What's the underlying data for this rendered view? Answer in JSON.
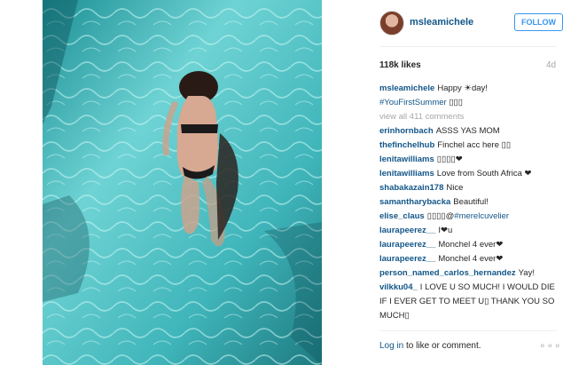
{
  "post": {
    "username": "msleamichele",
    "follow_label": "FOLLOW",
    "likes": "118k likes",
    "time": "4d",
    "caption_user": "msleamichele",
    "caption_text": "Happy ☀day!",
    "caption_tag": "#YouFirstSummer",
    "caption_tag_suffix": "▯▯▯",
    "view_all": "view all 411 comments"
  },
  "comments": [
    {
      "user": "erinhornbach",
      "text": "ASSS YAS MOM"
    },
    {
      "user": "thefinchelhub",
      "text": "Finchel acc here ▯▯"
    },
    {
      "user": "lenitawilliams",
      "text": "▯▯▯▯❤"
    },
    {
      "user": "lenitawilliams",
      "text": "Love from South Africa ❤"
    },
    {
      "user": "shabakazain178",
      "text": "Nice"
    },
    {
      "user": "samantharybacka",
      "text": "Beautiful!"
    },
    {
      "user": "elise_claus",
      "text": "▯▯▯▯@",
      "mention": "#merelcuvelier"
    },
    {
      "user": "laurapeerez__",
      "text": "I❤u"
    },
    {
      "user": "laurapeerez__",
      "text": "Monchel 4 ever❤"
    },
    {
      "user": "laurapeerez__",
      "text": "Monchel 4 ever❤"
    },
    {
      "user": "person_named_carlos_hernandez",
      "text": "Yay!"
    },
    {
      "user": "vilkku04_",
      "text": "I LOVE U SO MUCH! I WOULD DIE IF I EVER GET TO MEET U▯ THANK YOU SO MUCH▯"
    }
  ],
  "footer": {
    "login_link": "Log in",
    "login_text": " to like or comment.",
    "more_icon": "more-options-icon",
    "more_glyph": "∘∘∘"
  },
  "colors": {
    "link": "#125688",
    "follow": "#3897f0",
    "water_light": "#8fe3e4",
    "water_dark": "#147e86"
  }
}
